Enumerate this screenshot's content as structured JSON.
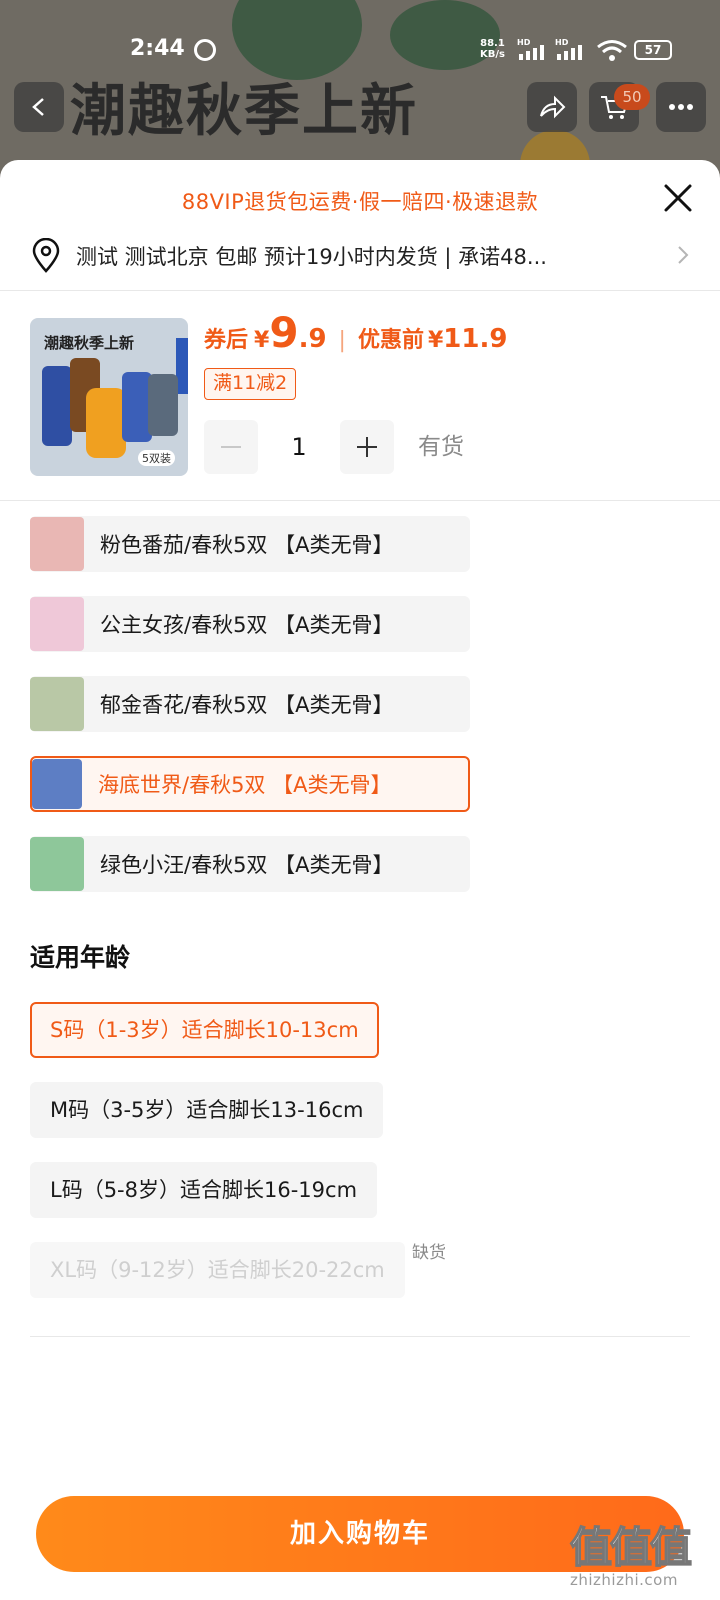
{
  "status_bar": {
    "time": "2:44",
    "net_speed_value": "88.1",
    "net_speed_unit": "KB/s",
    "signal1_label": "HD",
    "signal2_label": "HD",
    "battery": "57"
  },
  "background_page": {
    "banner": "潮趣秋季上新",
    "cart_count": "50"
  },
  "sheet": {
    "vip_notice": "88VIP退货包运费·假一赔四·极速退款",
    "address": "测试 测试北京  包邮  预计19小时内发货 | 承诺48..."
  },
  "product": {
    "thumb_title": "潮趣秋季上新",
    "thumb_count": "5双装",
    "price_label": "券后",
    "currency": "¥",
    "price_int": "9",
    "price_dec": ".9",
    "separator": "|",
    "orig_label": "优惠前",
    "orig_price": "11.9",
    "promo": "满11减2",
    "quantity": "1",
    "stock": "有货"
  },
  "variants": [
    {
      "label": "粉色番茄/春秋5双 【A类无骨】",
      "selected": false,
      "color": "#e9b7b4"
    },
    {
      "label": "公主女孩/春秋5双 【A类无骨】",
      "selected": false,
      "color": "#efc8d8"
    },
    {
      "label": "郁金香花/春秋5双 【A类无骨】",
      "selected": false,
      "color": "#b9c8a6"
    },
    {
      "label": "海底世界/春秋5双 【A类无骨】",
      "selected": true,
      "color": "#5d7ec4"
    },
    {
      "label": "绿色小汪/春秋5双 【A类无骨】",
      "selected": false,
      "color": "#8ec79a"
    }
  ],
  "age_section": {
    "title": "适用年龄",
    "options": [
      {
        "label": "S码（1-3岁）适合脚长10-13cm",
        "state": "selected"
      },
      {
        "label": "M码（3-5岁）适合脚长13-16cm",
        "state": "normal"
      },
      {
        "label": "L码（5-8岁）适合脚长16-19cm",
        "state": "normal"
      },
      {
        "label": "XL码（9-12岁）适合脚长20-22cm",
        "state": "disabled"
      }
    ],
    "out_of_stock": "缺货"
  },
  "add_to_cart": "加入购物车",
  "watermark": {
    "logo": "值值值",
    "url": "zhizhizhi.com"
  },
  "colors": {
    "accent": "#f05a17",
    "button_gradient_start": "#ff8a1a",
    "button_gradient_end": "#ff6a1a"
  }
}
